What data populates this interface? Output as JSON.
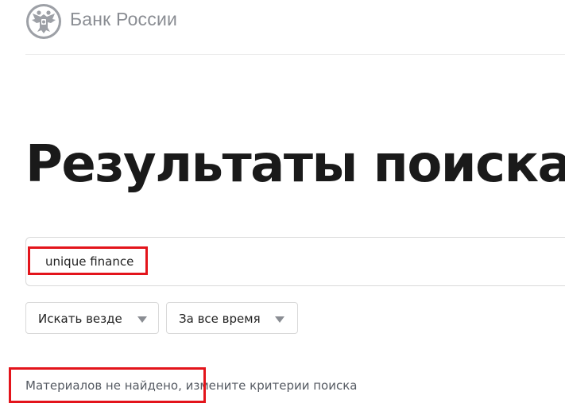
{
  "header": {
    "logo_text": "Банк России"
  },
  "main": {
    "title": "Результаты поиска",
    "search": {
      "value": "unique finance",
      "placeholder": ""
    },
    "filters": {
      "where_label": "Искать везде",
      "time_label": "За все время"
    },
    "empty_message": "Материалов не найдено, измените критерии поиска"
  },
  "colors": {
    "highlight": "#e3141b",
    "logo_gray": "#8a8d93"
  },
  "icons": [
    "bank-emblem-icon",
    "dropdown-caret-icon"
  ]
}
